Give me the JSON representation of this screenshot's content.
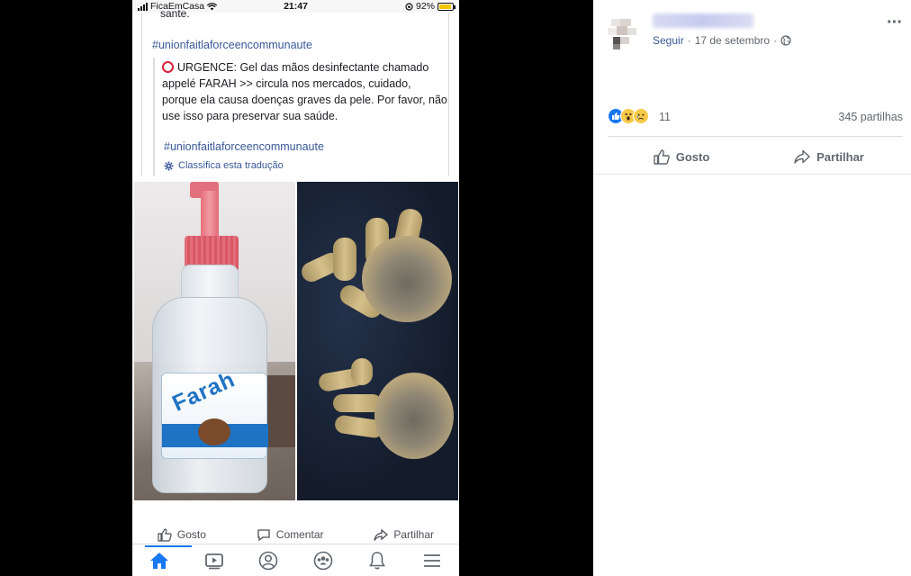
{
  "phone": {
    "status_bar": {
      "carrier": "FicaEmCasa",
      "time": "21:47",
      "battery": "92%"
    },
    "post": {
      "cut_text": "sante.",
      "hashtag_top": "#unionfaitlaforceencommunaute",
      "quote_text": "URGENCE: Gel das mãos desinfectante chamado appelé FARAH >> circula nos mercados, cuidado, porque ela causa doenças graves da pele. Por favor, não use isso para preservar sua saúde.",
      "hashtag_bottom": "#unionfaitlaforceencommunaute",
      "translate_link": "Classifica esta tradução"
    },
    "photo": {
      "bottle_brand": "Farah"
    },
    "actions": {
      "like": "Gosto",
      "comment": "Comentar",
      "share": "Partilhar"
    },
    "nav": [
      "home-icon",
      "video-icon",
      "profile-icon",
      "groups-icon",
      "bell-icon",
      "menu-icon"
    ]
  },
  "fb": {
    "meta": {
      "follow": "Seguir",
      "separator": "·",
      "date": "17 de setembro",
      "separator2": "·"
    },
    "more": "···",
    "reaction_count": "11",
    "shares": "345 partilhas",
    "actions": {
      "like": "Gosto",
      "share": "Partilhar"
    }
  },
  "colors": {
    "fb_link": "#385898",
    "fb_blue": "#1877f2",
    "text_secondary": "#606770"
  }
}
